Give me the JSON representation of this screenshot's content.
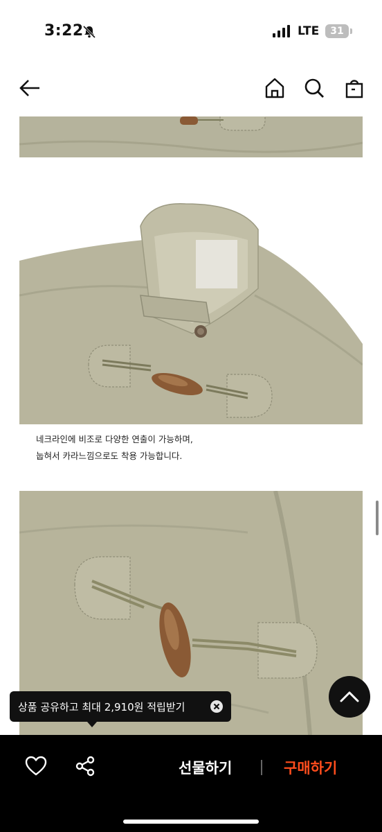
{
  "status_bar": {
    "time": "3:22",
    "network": "LTE",
    "battery": "31"
  },
  "nav": {
    "icons": [
      "back-arrow-icon",
      "home-icon",
      "search-icon",
      "shopping-bag-icon"
    ]
  },
  "content": {
    "caption_line1": "네크라인에 비조로 다양한 연출이 가능하며,",
    "caption_line2": "눕혀서 카라느낌으로도 착용 가능합니다."
  },
  "toast": {
    "text": "상품 공유하고 최대 2,910원 적립받기"
  },
  "bottom_bar": {
    "gift_label": "선물하기",
    "buy_label": "구매하기"
  },
  "colors": {
    "accent": "#ff4d1d",
    "fabric": "#b7b49b",
    "toggle": "#8a5a35"
  }
}
